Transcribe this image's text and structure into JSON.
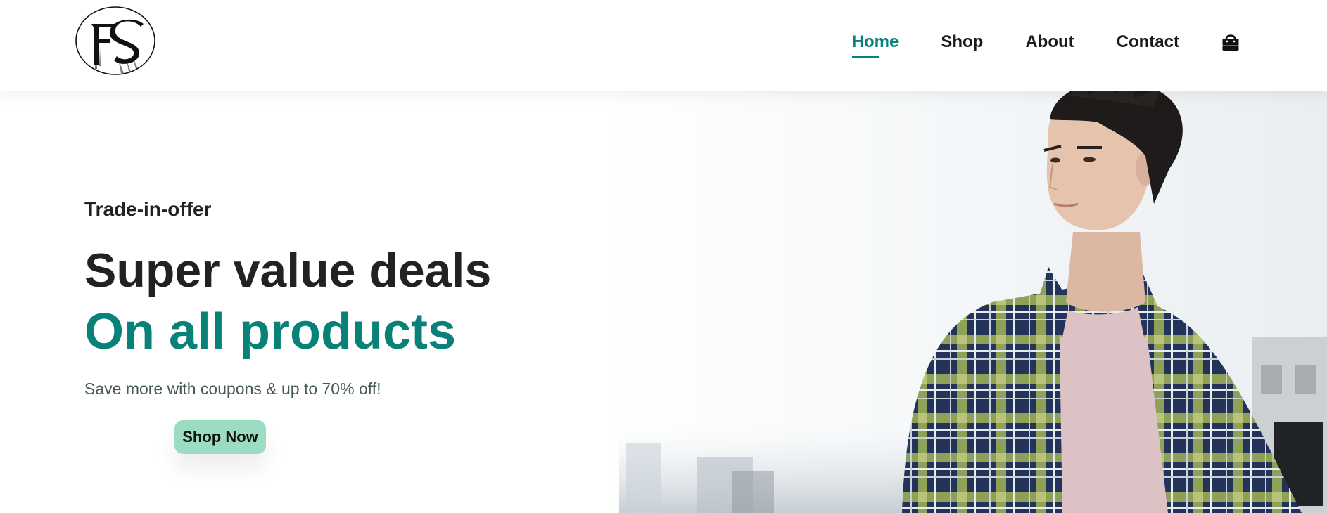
{
  "brand": {
    "logo_alt": "FS",
    "logo_letters": "FS"
  },
  "nav": {
    "items": [
      {
        "label": "Home",
        "active": true
      },
      {
        "label": "Shop",
        "active": false
      },
      {
        "label": "About",
        "active": false
      },
      {
        "label": "Contact",
        "active": false
      }
    ],
    "cart_icon": "shopping-bag-icon"
  },
  "hero": {
    "eyebrow": "Trade-in-offer",
    "headline": "Super value deals",
    "subheadline": "On all products",
    "tagline": "Save more with coupons & up to 70% off!",
    "button_label": "Shop Now",
    "image_description_icon": "model-photo"
  },
  "colors": {
    "accent": "#088178",
    "button_bg": "#9bdcc2",
    "text_dark": "#222222",
    "text_muted": "#465b52"
  }
}
